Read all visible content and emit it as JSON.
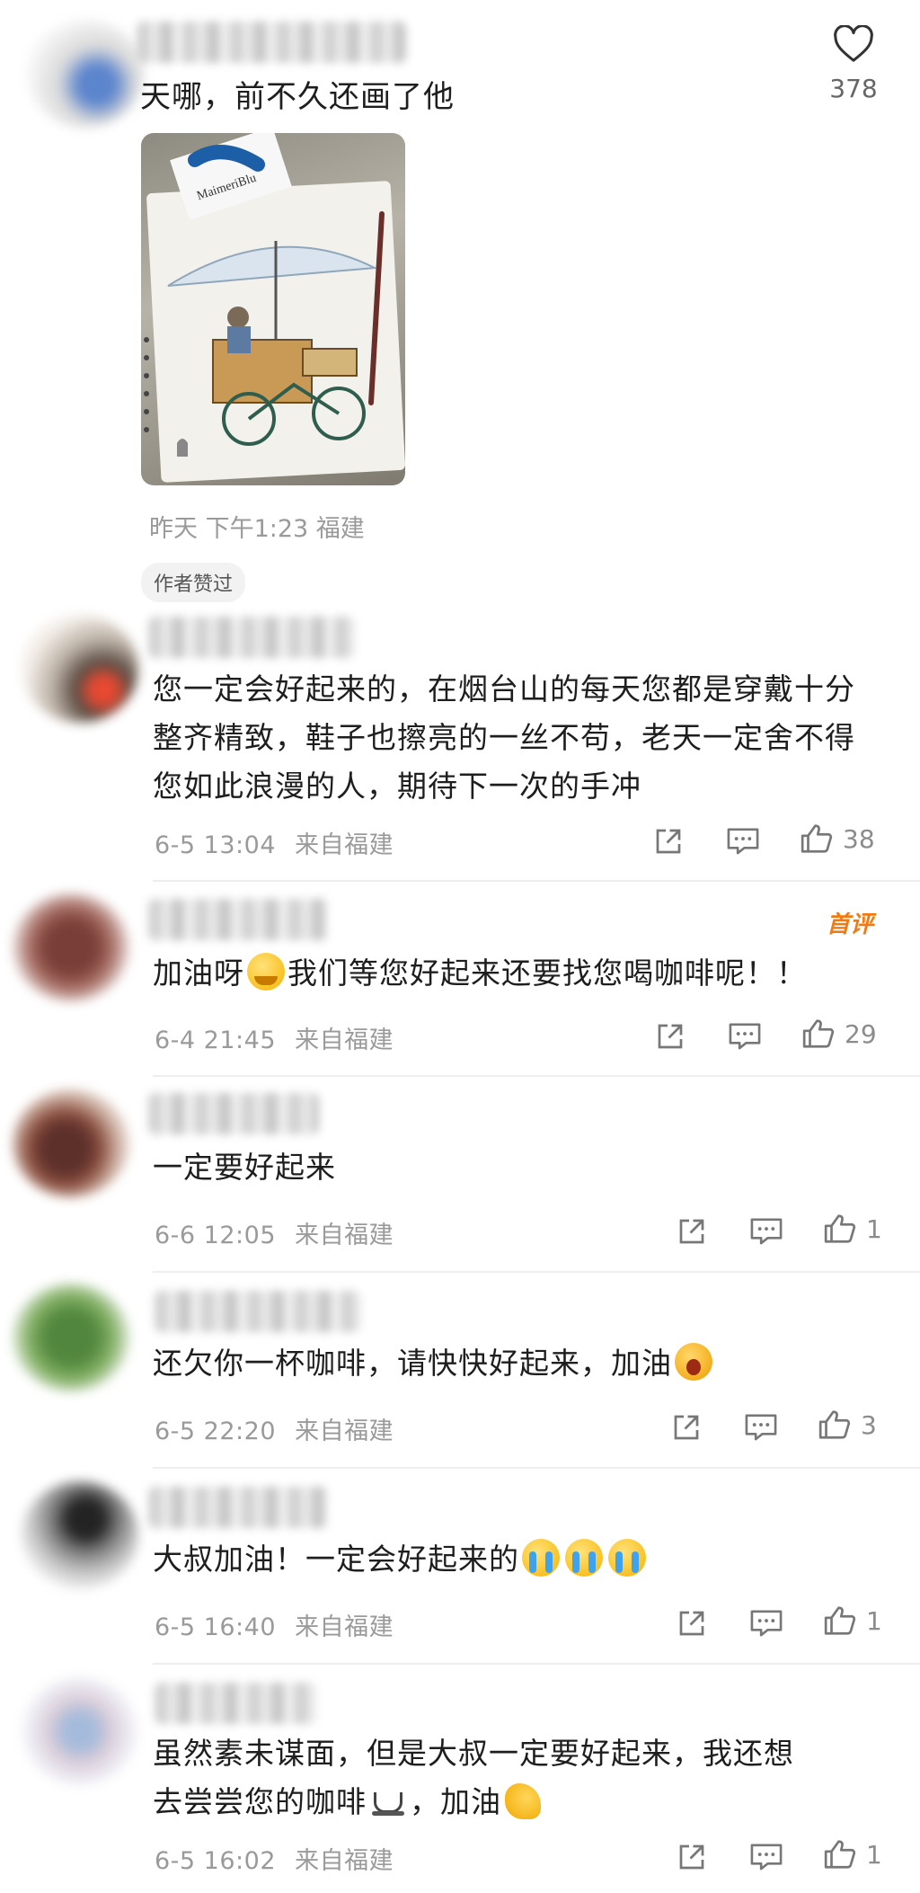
{
  "top_comment": {
    "text": "天哪，前不久还画了他",
    "like_count": "378",
    "meta": "昨天 下午1:23 福建",
    "author_liked_badge": "作者赞过",
    "image_text": "MaimeriBlu"
  },
  "replies": [
    {
      "text": "您一定会好起来的，在烟台山的每天您都是穿戴十分整齐精致，鞋子也擦亮的一丝不苟，老天一定舍不得您如此浪漫的人，期待下一次的手冲",
      "time": "6-5 13:04",
      "location": "来自福建",
      "likes": "38"
    },
    {
      "text_before": "加油呀",
      "text_after": "我们等您好起来还要找您喝咖啡呢！！",
      "badge": "首评",
      "time": "6-4 21:45",
      "location": "来自福建",
      "likes": "29"
    },
    {
      "text": "一定要好起来",
      "time": "6-6 12:05",
      "location": "来自福建",
      "likes": "1"
    },
    {
      "text": "还欠你一杯咖啡，请快快好起来，加油",
      "time": "6-5 22:20",
      "location": "来自福建",
      "likes": "3"
    },
    {
      "text": "大叔加油！一定会好起来的",
      "time": "6-5 16:40",
      "location": "来自福建",
      "likes": "1"
    },
    {
      "text_line1": "虽然素未谋面，但是大叔一定要好起来，我还想",
      "text_line2_before": "去尝尝您的咖啡",
      "text_line2_after": "，加油",
      "time": "6-5 16:02",
      "location": "来自福建",
      "likes": "1"
    }
  ],
  "colors": {
    "accent_badge": "#f07b13",
    "meta_text": "#9a9a9a",
    "badge_bg": "#f2f2f2"
  }
}
